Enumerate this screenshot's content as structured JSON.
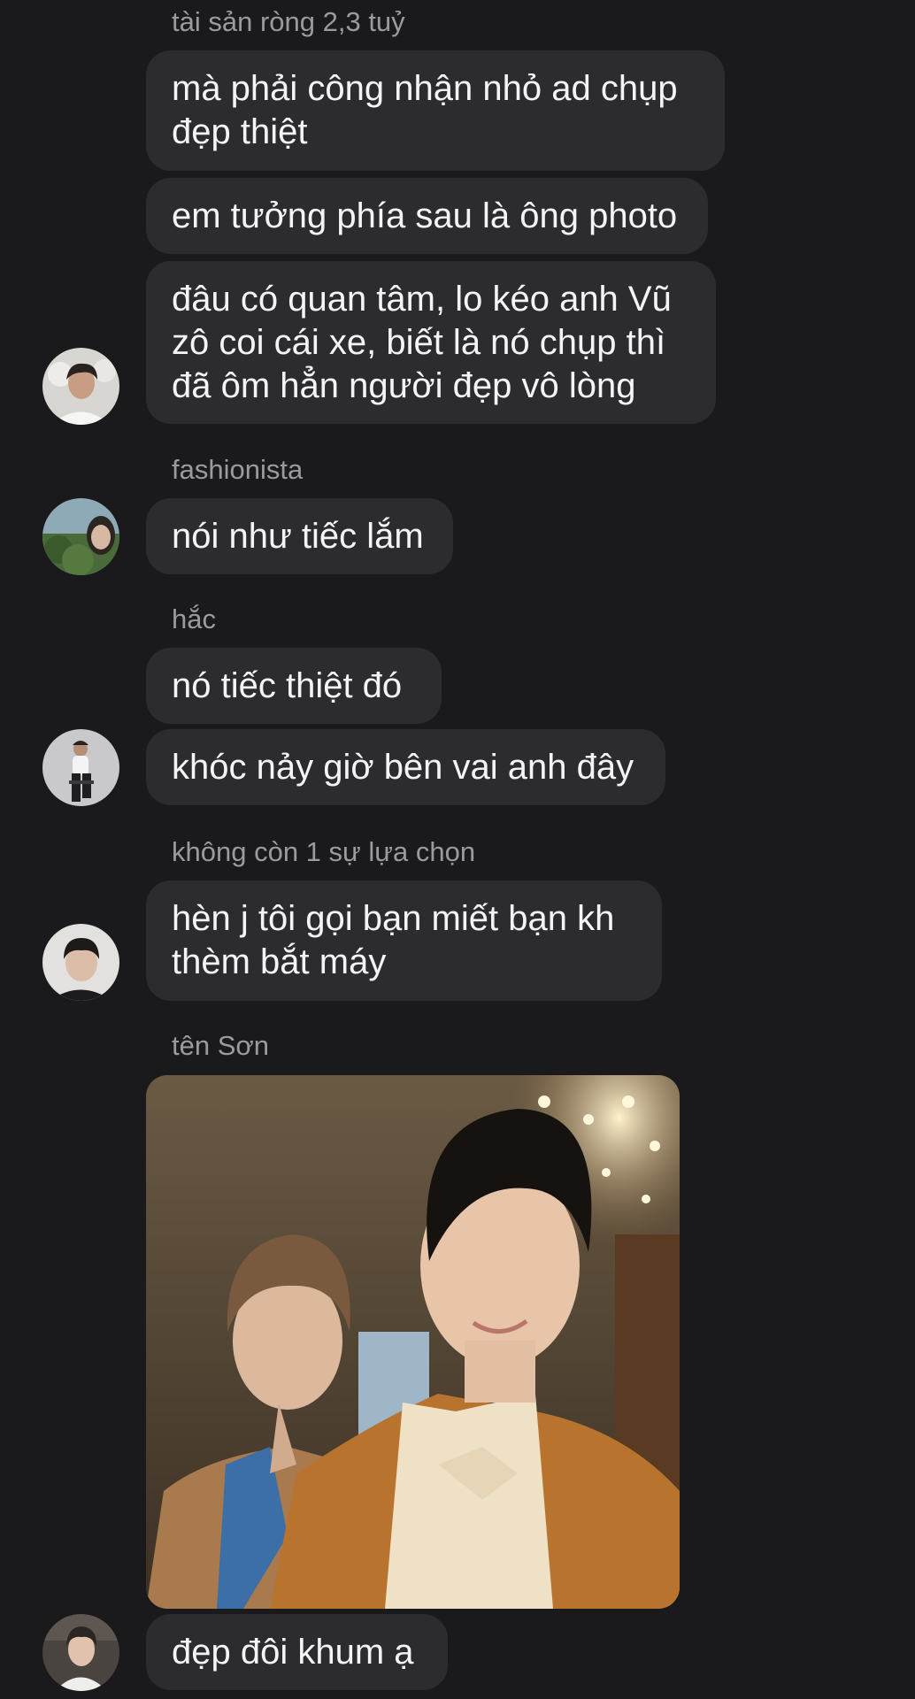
{
  "conversation": {
    "groups": [
      {
        "sender": "tài sản ròng 2,3 tuỷ",
        "messages": [
          [
            "mà phải công nhận nhỏ ad chụp",
            "đẹp thiệt"
          ],
          [
            "em tưởng phía sau là ông photo"
          ],
          [
            "đâu có quan tâm, lo kéo anh Vũ",
            "zô coi cái xe, biết là nó chụp thì",
            "đã ôm hẳn người đẹp vô lòng"
          ]
        ],
        "avatar": "avatar-man-white-shirt"
      },
      {
        "sender": "fashionista",
        "messages": [
          [
            "nói như tiếc lắm"
          ]
        ],
        "avatar": "avatar-landscape-selfie"
      },
      {
        "sender": "hắc",
        "messages": [
          [
            "nó tiếc thiệt đó"
          ],
          [
            "khóc nảy giờ bên vai anh đây"
          ]
        ],
        "avatar": "avatar-man-seated"
      },
      {
        "sender": "không còn 1 sự lựa chọn",
        "messages": [
          [
            "hèn j tôi gọi bạn miết bạn kh",
            "thèm bắt máy"
          ]
        ],
        "avatar": "avatar-young-man"
      },
      {
        "sender": "tên Sơn",
        "photo": "shared-photo-two-men",
        "messages": [
          [
            "đẹp đôi khum ạ"
          ]
        ],
        "avatar": "avatar-man-portrait"
      }
    ]
  },
  "colors": {
    "background": "#1a1a1d",
    "bubble": "#2c2c30",
    "text": "#f4f4f6",
    "sender": "#9a9aa0"
  }
}
